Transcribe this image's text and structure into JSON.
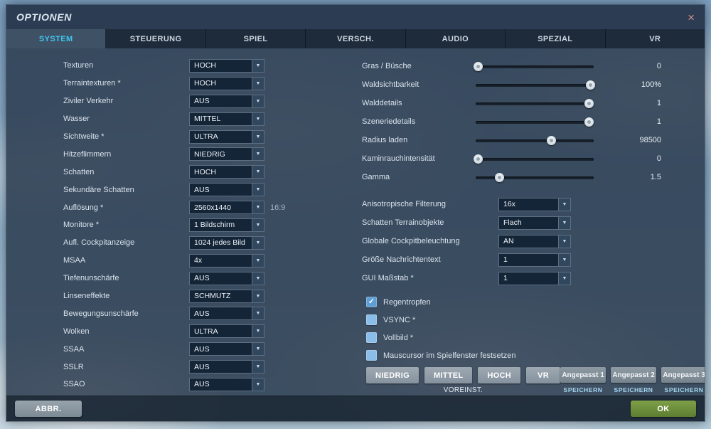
{
  "window": {
    "title": "OPTIONEN",
    "close": "×"
  },
  "icons": {
    "chevron_down": "▼",
    "check": "✓"
  },
  "tabs": [
    {
      "label": "SYSTEM",
      "active": true
    },
    {
      "label": "STEUERUNG",
      "active": false
    },
    {
      "label": "SPIEL",
      "active": false
    },
    {
      "label": "VERSCH.",
      "active": false
    },
    {
      "label": "AUDIO",
      "active": false
    },
    {
      "label": "SPEZIAL",
      "active": false
    },
    {
      "label": "VR",
      "active": false
    }
  ],
  "left_dropdowns": [
    {
      "label": "Texturen",
      "value": "HOCH",
      "suffix": ""
    },
    {
      "label": "Terraintexturen *",
      "value": "HOCH",
      "suffix": ""
    },
    {
      "label": "Ziviler Verkehr",
      "value": "AUS",
      "suffix": ""
    },
    {
      "label": "Wasser",
      "value": "MITTEL",
      "suffix": ""
    },
    {
      "label": "Sichtweite *",
      "value": "ULTRA",
      "suffix": ""
    },
    {
      "label": "Hitzeflimmern",
      "value": "NIEDRIG",
      "suffix": ""
    },
    {
      "label": "Schatten",
      "value": "HOCH",
      "suffix": ""
    },
    {
      "label": "Sekundäre Schatten",
      "value": "AUS",
      "suffix": ""
    },
    {
      "label": "Auflösung *",
      "value": "2560x1440",
      "suffix": "16:9"
    },
    {
      "label": "Monitore *",
      "value": "1 Bildschirm",
      "suffix": ""
    },
    {
      "label": "Aufl. Cockpitanzeige",
      "value": "1024 jedes Bild",
      "suffix": ""
    },
    {
      "label": "MSAA",
      "value": "4x",
      "suffix": ""
    },
    {
      "label": "Tiefenunschärfe",
      "value": "AUS",
      "suffix": ""
    },
    {
      "label": "Linseneffekte",
      "value": "SCHMUTZ",
      "suffix": ""
    },
    {
      "label": "Bewegungsunschärfe",
      "value": "AUS",
      "suffix": ""
    },
    {
      "label": "Wolken",
      "value": "ULTRA",
      "suffix": ""
    },
    {
      "label": "SSAA",
      "value": "AUS",
      "suffix": ""
    },
    {
      "label": "SSLR",
      "value": "AUS",
      "suffix": ""
    },
    {
      "label": "SSAO",
      "value": "AUS",
      "suffix": ""
    }
  ],
  "sliders": [
    {
      "label": "Gras / Büsche",
      "value": "0",
      "percent": 2
    },
    {
      "label": "Waldsichtbarkeit",
      "value": "100%",
      "percent": 97
    },
    {
      "label": "Walddetails",
      "value": "1",
      "percent": 96
    },
    {
      "label": "Szeneriedetails",
      "value": "1",
      "percent": 96
    },
    {
      "label": "Radius laden",
      "value": "98500",
      "percent": 64
    },
    {
      "label": "Kaminrauchintensität",
      "value": "0",
      "percent": 2
    },
    {
      "label": "Gamma",
      "value": "1.5",
      "percent": 20
    }
  ],
  "right_dropdowns": [
    {
      "label": "Anisotropische Filterung",
      "value": "16x"
    },
    {
      "label": "Schatten Terrainobjekte",
      "value": "Flach"
    },
    {
      "label": "Globale Cockpitbeleuchtung",
      "value": "AN"
    },
    {
      "label": "Größe Nachrichtentext",
      "value": "1"
    },
    {
      "label": "GUI Maßstab *",
      "value": "1"
    }
  ],
  "checkboxes": [
    {
      "label": "Regentropfen",
      "checked": true
    },
    {
      "label": "VSYNC *",
      "checked": false
    },
    {
      "label": "Vollbild *",
      "checked": false
    },
    {
      "label": "Mauscursor im Spielfenster festsetzen",
      "checked": false
    }
  ],
  "presets": {
    "buttons": [
      {
        "label": "NIEDRIG"
      },
      {
        "label": "MITTEL"
      },
      {
        "label": "HOCH"
      },
      {
        "label": "VR"
      }
    ],
    "caption": "VOREINST.",
    "custom": [
      {
        "label": "Angepasst 1",
        "action": "SPEICHERN"
      },
      {
        "label": "Angepasst 2",
        "action": "SPEICHERN"
      },
      {
        "label": "Angepasst 3",
        "action": "SPEICHERN"
      }
    ]
  },
  "footer": {
    "cancel": "ABBR.",
    "ok": "OK"
  },
  "colors": {
    "accent_cyan": "#41c6ef",
    "ok_green": "#6a8f3b",
    "checkbox_blue": "#8abde8",
    "save_link": "#a5d9f2"
  }
}
